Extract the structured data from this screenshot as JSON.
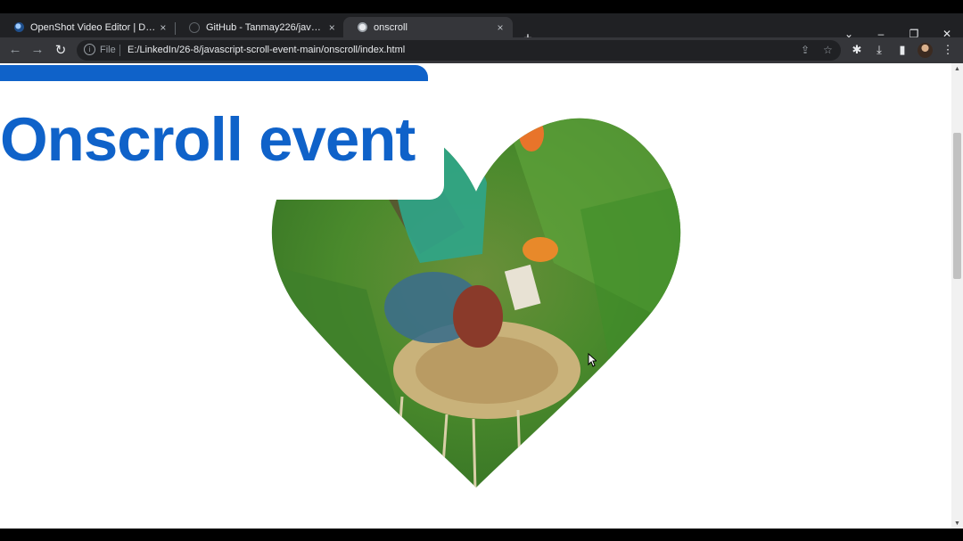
{
  "browser": {
    "tabs": [
      {
        "title": "OpenShot Video Editor | Downlo",
        "active": false
      },
      {
        "title": "GitHub - Tanmay226/javascript-s",
        "active": false
      },
      {
        "title": "onscroll",
        "active": true
      }
    ],
    "address": {
      "scheme_label": "File",
      "url": "E:/LinkedIn/26-8/javascript-scroll-event-main/onscroll/index.html"
    }
  },
  "icons": {
    "close": "×",
    "new_tab": "+",
    "back": "←",
    "forward": "→",
    "reload": "↻",
    "info": "i",
    "share": "⇪",
    "star": "☆",
    "extensions": "✱",
    "download": "⤓",
    "sidepanel": "▮",
    "menu": "⋮",
    "tabsearch": "⌄",
    "minimize": "–",
    "maximize": "❐",
    "window_close": "✕",
    "scroll_up": "▲",
    "scroll_down": "▼"
  },
  "page": {
    "heading": "Onscroll event",
    "accent_color": "#0f62c9"
  }
}
